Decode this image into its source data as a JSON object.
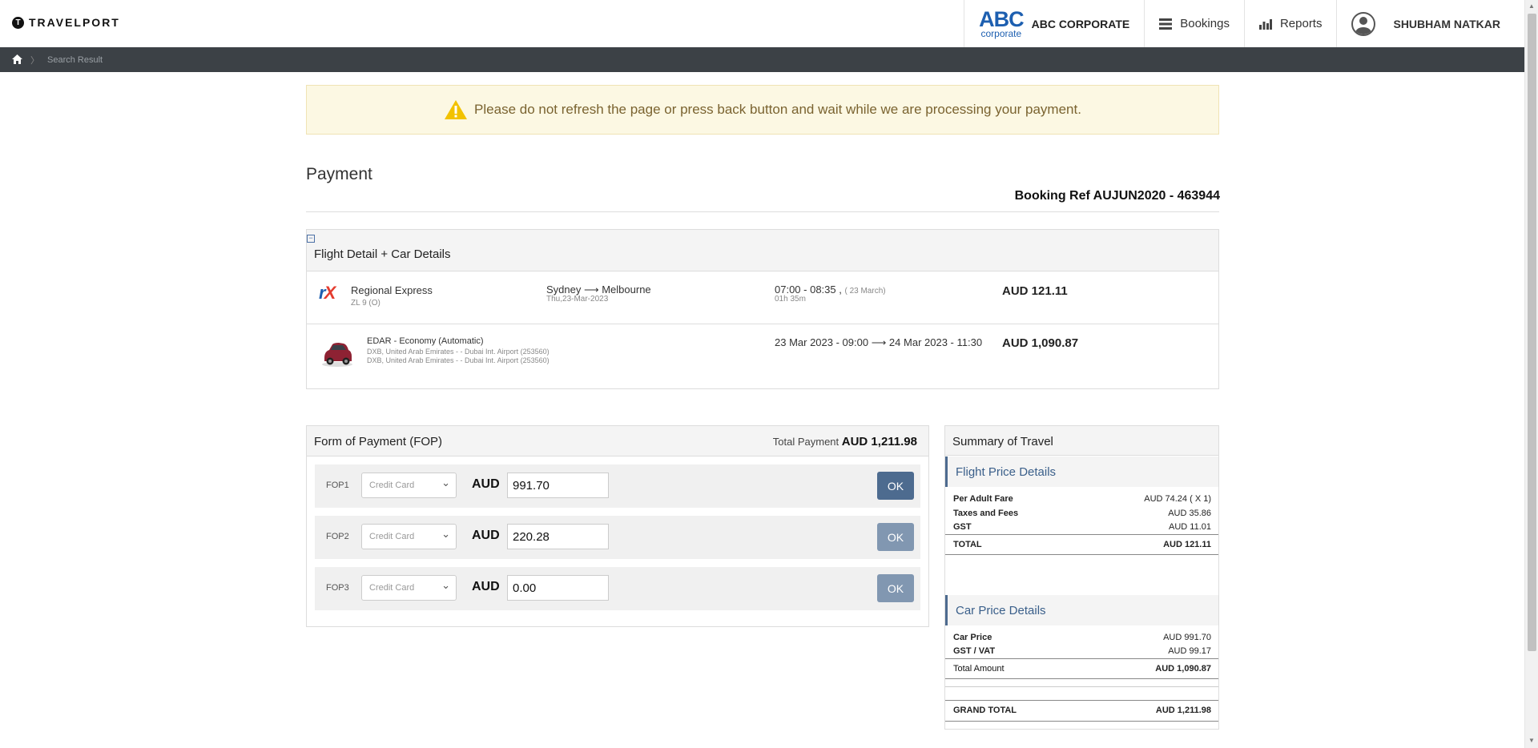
{
  "brand": {
    "name": "TRAVELPORT",
    "mark": "T"
  },
  "header": {
    "corp_logo_main": "ABC",
    "corp_logo_sub": "corporate",
    "corp_name": "ABC CORPORATE",
    "bookings_label": "Bookings",
    "reports_label": "Reports",
    "user_name": "SHUBHAM NATKAR"
  },
  "breadcrumb": {
    "current": "Search Result"
  },
  "alert": {
    "text": "Please do not refresh the page or press back button and wait while we are processing your payment."
  },
  "page": {
    "title": "Payment",
    "booking_ref": "Booking Ref AUJUN2020 - 463944"
  },
  "details": {
    "title": "Flight Detail + Car Details",
    "flight": {
      "airline": "Regional Express",
      "flight_no": "ZL 9 (O)",
      "route": "Sydney ⟶ Melbourne",
      "date": "Thu,23-Mar-2023",
      "time": "07:00 - 08:35 ,",
      "time_date": "( 23 March)",
      "duration": "01h 35m",
      "price": "AUD 121.11"
    },
    "car": {
      "name": "EDAR - Economy (Automatic)",
      "pickup": "DXB, United Arab Emirates - - Dubai Int. Airport (253560)",
      "dropoff": "DXB, United Arab Emirates - - Dubai Int. Airport (253560)",
      "dates": "23 Mar 2023 - 09:00 ⟶ 24 Mar 2023 - 11:30",
      "price": "AUD 1,090.87"
    }
  },
  "fop": {
    "title": "Form of Payment (FOP)",
    "total_label": "Total Payment",
    "total_value": "AUD 1,211.98",
    "rows": [
      {
        "label": "FOP1",
        "method": "Credit Card",
        "currency": "AUD",
        "amount": "991.70",
        "button": "OK"
      },
      {
        "label": "FOP2",
        "method": "Credit Card",
        "currency": "AUD",
        "amount": "220.28",
        "button": "OK"
      },
      {
        "label": "FOP3",
        "method": "Credit Card",
        "currency": "AUD",
        "amount": "0.00",
        "button": "OK"
      }
    ]
  },
  "summary": {
    "title": "Summary of Travel",
    "flight_title": "Flight Price Details",
    "flight_lines": [
      {
        "label": "Per Adult Fare",
        "value": "AUD 74.24 ( X 1)"
      },
      {
        "label": "Taxes and Fees",
        "value": "AUD 35.86"
      },
      {
        "label": "GST",
        "value": "AUD 11.01"
      }
    ],
    "flight_total_label": "TOTAL",
    "flight_total_value": "AUD 121.11",
    "car_title": "Car Price Details",
    "car_lines": [
      {
        "label": "Car Price",
        "value": "AUD 991.70"
      },
      {
        "label": "GST / VAT",
        "value": "AUD 99.17"
      }
    ],
    "car_total_label": "Total Amount",
    "car_total_value": "AUD 1,090.87",
    "grand_total_label": "GRAND TOTAL",
    "grand_total_value": "AUD 1,211.98"
  }
}
